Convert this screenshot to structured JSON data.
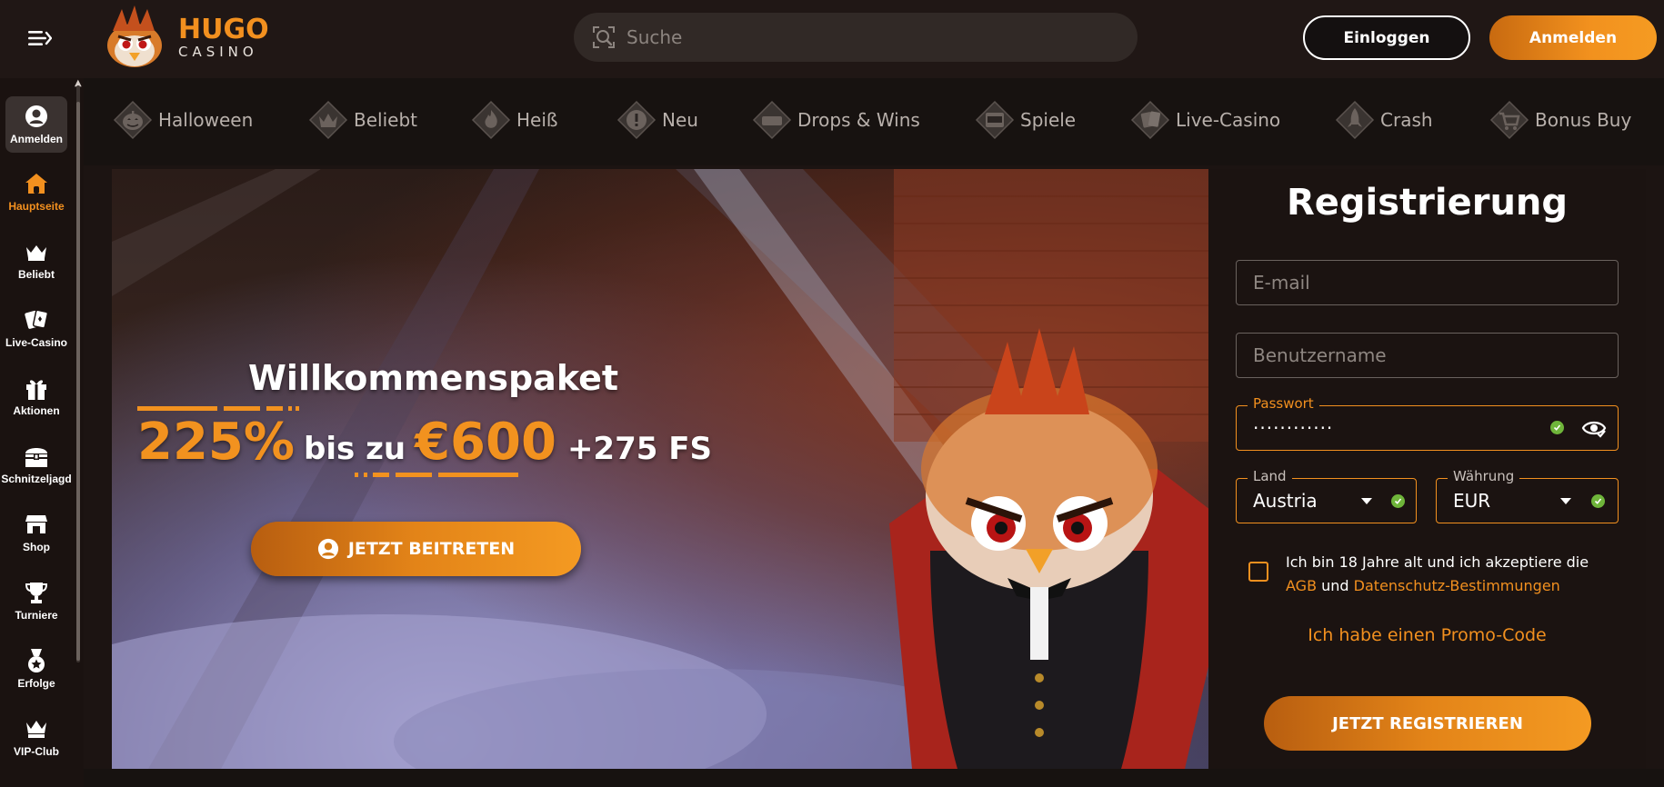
{
  "header": {
    "logo": {
      "brand": "HUGO",
      "sub": "CASINO"
    },
    "search_placeholder": "Suche",
    "login_label": "Einloggen",
    "register_label": "Anmelden"
  },
  "sidebar": {
    "items": [
      {
        "label": "Anmelden",
        "icon": "user-circle-icon"
      },
      {
        "label": "Hauptseite",
        "icon": "home-icon"
      },
      {
        "label": "Beliebt",
        "icon": "crown-icon"
      },
      {
        "label": "Live-Casino",
        "icon": "playing-cards-icon"
      },
      {
        "label": "Aktionen",
        "icon": "gift-icon"
      },
      {
        "label": "Schnitzeljagd",
        "icon": "treasure-chest-icon"
      },
      {
        "label": "Shop",
        "icon": "shop-icon"
      },
      {
        "label": "Turniere",
        "icon": "trophy-icon"
      },
      {
        "label": "Erfolge",
        "icon": "medal-icon"
      },
      {
        "label": "VIP-Club",
        "icon": "vip-crown-icon"
      }
    ]
  },
  "categories": [
    {
      "label": "Halloween",
      "icon": "pumpkin-icon"
    },
    {
      "label": "Beliebt",
      "icon": "crown-badge-icon"
    },
    {
      "label": "Heiß",
      "icon": "flame-icon"
    },
    {
      "label": "Neu",
      "icon": "exclamation-badge-icon"
    },
    {
      "label": "Drops & Wins",
      "icon": "drops-wins-icon"
    },
    {
      "label": "Spiele",
      "icon": "slot-777-icon"
    },
    {
      "label": "Live-Casino",
      "icon": "cards-badge-icon"
    },
    {
      "label": "Crash",
      "icon": "rocket-icon"
    },
    {
      "label": "Bonus Buy",
      "icon": "cart-star-icon"
    }
  ],
  "hero": {
    "title": "Willkommenspaket",
    "percent": "225%",
    "mid": "bis zu",
    "amount": "€600",
    "freespins": "+275 FS",
    "cta": "JETZT BEITRETEN"
  },
  "registration": {
    "title": "Registrierung",
    "email_placeholder": "E-mail",
    "username_placeholder": "Benutzername",
    "password_label": "Passwort",
    "password_value": "············",
    "country_label": "Land",
    "country_value": "Austria",
    "currency_label": "Währung",
    "currency_value": "EUR",
    "agree_text": "Ich bin 18 Jahre alt und ich akzeptiere die",
    "agree_link_terms": "AGB",
    "agree_and": "und",
    "agree_link_privacy": "Datenschutz-Bestimmungen",
    "promo_link": "Ich habe einen Promo-Code",
    "submit": "JETZT REGISTRIEREN"
  },
  "colors": {
    "accent": "#f2901f",
    "background": "#1c1412",
    "valid": "#6fb53a"
  }
}
